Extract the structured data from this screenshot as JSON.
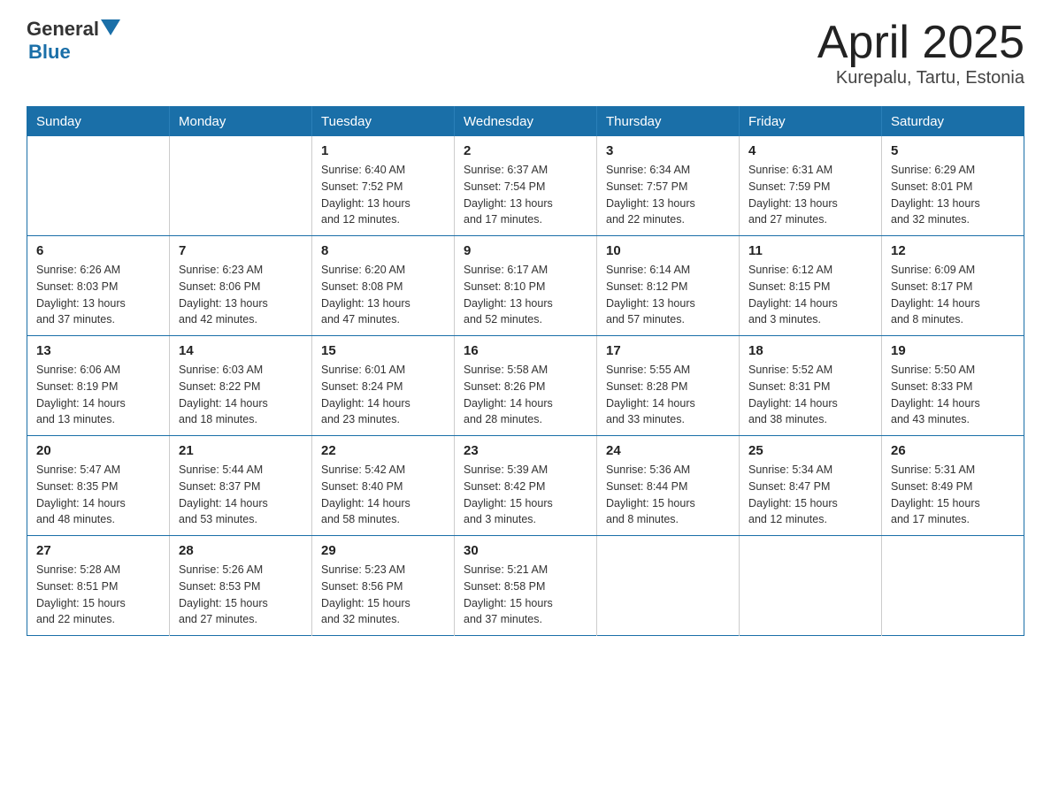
{
  "header": {
    "logo_text_general": "General",
    "logo_text_blue": "Blue",
    "title": "April 2025",
    "subtitle": "Kurepalu, Tartu, Estonia"
  },
  "calendar": {
    "weekdays": [
      "Sunday",
      "Monday",
      "Tuesday",
      "Wednesday",
      "Thursday",
      "Friday",
      "Saturday"
    ],
    "weeks": [
      [
        {
          "day": "",
          "info": ""
        },
        {
          "day": "",
          "info": ""
        },
        {
          "day": "1",
          "info": "Sunrise: 6:40 AM\nSunset: 7:52 PM\nDaylight: 13 hours\nand 12 minutes."
        },
        {
          "day": "2",
          "info": "Sunrise: 6:37 AM\nSunset: 7:54 PM\nDaylight: 13 hours\nand 17 minutes."
        },
        {
          "day": "3",
          "info": "Sunrise: 6:34 AM\nSunset: 7:57 PM\nDaylight: 13 hours\nand 22 minutes."
        },
        {
          "day": "4",
          "info": "Sunrise: 6:31 AM\nSunset: 7:59 PM\nDaylight: 13 hours\nand 27 minutes."
        },
        {
          "day": "5",
          "info": "Sunrise: 6:29 AM\nSunset: 8:01 PM\nDaylight: 13 hours\nand 32 minutes."
        }
      ],
      [
        {
          "day": "6",
          "info": "Sunrise: 6:26 AM\nSunset: 8:03 PM\nDaylight: 13 hours\nand 37 minutes."
        },
        {
          "day": "7",
          "info": "Sunrise: 6:23 AM\nSunset: 8:06 PM\nDaylight: 13 hours\nand 42 minutes."
        },
        {
          "day": "8",
          "info": "Sunrise: 6:20 AM\nSunset: 8:08 PM\nDaylight: 13 hours\nand 47 minutes."
        },
        {
          "day": "9",
          "info": "Sunrise: 6:17 AM\nSunset: 8:10 PM\nDaylight: 13 hours\nand 52 minutes."
        },
        {
          "day": "10",
          "info": "Sunrise: 6:14 AM\nSunset: 8:12 PM\nDaylight: 13 hours\nand 57 minutes."
        },
        {
          "day": "11",
          "info": "Sunrise: 6:12 AM\nSunset: 8:15 PM\nDaylight: 14 hours\nand 3 minutes."
        },
        {
          "day": "12",
          "info": "Sunrise: 6:09 AM\nSunset: 8:17 PM\nDaylight: 14 hours\nand 8 minutes."
        }
      ],
      [
        {
          "day": "13",
          "info": "Sunrise: 6:06 AM\nSunset: 8:19 PM\nDaylight: 14 hours\nand 13 minutes."
        },
        {
          "day": "14",
          "info": "Sunrise: 6:03 AM\nSunset: 8:22 PM\nDaylight: 14 hours\nand 18 minutes."
        },
        {
          "day": "15",
          "info": "Sunrise: 6:01 AM\nSunset: 8:24 PM\nDaylight: 14 hours\nand 23 minutes."
        },
        {
          "day": "16",
          "info": "Sunrise: 5:58 AM\nSunset: 8:26 PM\nDaylight: 14 hours\nand 28 minutes."
        },
        {
          "day": "17",
          "info": "Sunrise: 5:55 AM\nSunset: 8:28 PM\nDaylight: 14 hours\nand 33 minutes."
        },
        {
          "day": "18",
          "info": "Sunrise: 5:52 AM\nSunset: 8:31 PM\nDaylight: 14 hours\nand 38 minutes."
        },
        {
          "day": "19",
          "info": "Sunrise: 5:50 AM\nSunset: 8:33 PM\nDaylight: 14 hours\nand 43 minutes."
        }
      ],
      [
        {
          "day": "20",
          "info": "Sunrise: 5:47 AM\nSunset: 8:35 PM\nDaylight: 14 hours\nand 48 minutes."
        },
        {
          "day": "21",
          "info": "Sunrise: 5:44 AM\nSunset: 8:37 PM\nDaylight: 14 hours\nand 53 minutes."
        },
        {
          "day": "22",
          "info": "Sunrise: 5:42 AM\nSunset: 8:40 PM\nDaylight: 14 hours\nand 58 minutes."
        },
        {
          "day": "23",
          "info": "Sunrise: 5:39 AM\nSunset: 8:42 PM\nDaylight: 15 hours\nand 3 minutes."
        },
        {
          "day": "24",
          "info": "Sunrise: 5:36 AM\nSunset: 8:44 PM\nDaylight: 15 hours\nand 8 minutes."
        },
        {
          "day": "25",
          "info": "Sunrise: 5:34 AM\nSunset: 8:47 PM\nDaylight: 15 hours\nand 12 minutes."
        },
        {
          "day": "26",
          "info": "Sunrise: 5:31 AM\nSunset: 8:49 PM\nDaylight: 15 hours\nand 17 minutes."
        }
      ],
      [
        {
          "day": "27",
          "info": "Sunrise: 5:28 AM\nSunset: 8:51 PM\nDaylight: 15 hours\nand 22 minutes."
        },
        {
          "day": "28",
          "info": "Sunrise: 5:26 AM\nSunset: 8:53 PM\nDaylight: 15 hours\nand 27 minutes."
        },
        {
          "day": "29",
          "info": "Sunrise: 5:23 AM\nSunset: 8:56 PM\nDaylight: 15 hours\nand 32 minutes."
        },
        {
          "day": "30",
          "info": "Sunrise: 5:21 AM\nSunset: 8:58 PM\nDaylight: 15 hours\nand 37 minutes."
        },
        {
          "day": "",
          "info": ""
        },
        {
          "day": "",
          "info": ""
        },
        {
          "day": "",
          "info": ""
        }
      ]
    ]
  }
}
